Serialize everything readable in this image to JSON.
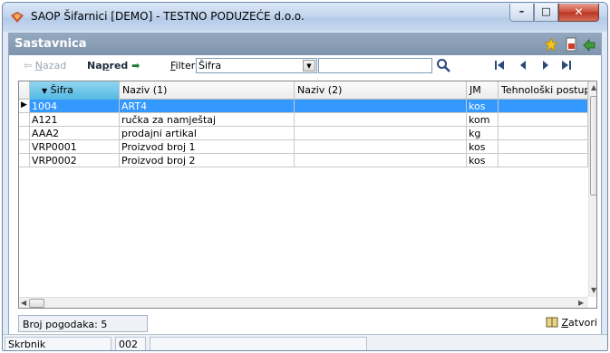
{
  "window": {
    "title": "SAOP Šifarnici [DEMO] - TESTNO PODUZEĆE d.o.o.",
    "controls": [
      "minimize",
      "maximize",
      "close"
    ]
  },
  "panel": {
    "title": "Sastavnica",
    "icons": [
      "star-icon",
      "report-icon",
      "export-icon"
    ]
  },
  "toolbar": {
    "back_prefix": "",
    "back_accel": "N",
    "back_rest": "azad",
    "next_prefix": "Na",
    "next_accel": "p",
    "next_rest": "red",
    "filter_accel": "F",
    "filter_rest": "ilter:",
    "filter_value": "Šifra",
    "search_value": ""
  },
  "grid": {
    "columns": [
      "Šifra",
      "Naziv (1)",
      "Naziv (2)",
      "JM",
      "Tehnološki postupak"
    ],
    "sorted_column": "Šifra",
    "rows": [
      {
        "sifra": "1004",
        "naziv1": "ART4",
        "naziv2": "",
        "jm": "kos",
        "tehn": "",
        "selected": true
      },
      {
        "sifra": "A121",
        "naziv1": "ručka za namještaj",
        "naziv2": "",
        "jm": "kom",
        "tehn": ""
      },
      {
        "sifra": "AAA2",
        "naziv1": "prodajni artikal",
        "naziv2": "",
        "jm": "kg",
        "tehn": ""
      },
      {
        "sifra": "VRP0001",
        "naziv1": "Proizvod broj 1",
        "naziv2": "",
        "jm": "kos",
        "tehn": ""
      },
      {
        "sifra": "VRP0002",
        "naziv1": "Proizvod broj 2",
        "naziv2": "",
        "jm": "kos",
        "tehn": ""
      }
    ]
  },
  "footer": {
    "count_text": "Broj pogodaka: 5",
    "close_accel": "Z",
    "close_rest": "atvori"
  },
  "statusbar": {
    "user": "Skrbnik",
    "code": "002"
  },
  "colors": {
    "selection": "#3399ff",
    "sorted_header": "#54b9e3",
    "panel_header": "#8aa0b8",
    "close_button": "#c94a36"
  }
}
